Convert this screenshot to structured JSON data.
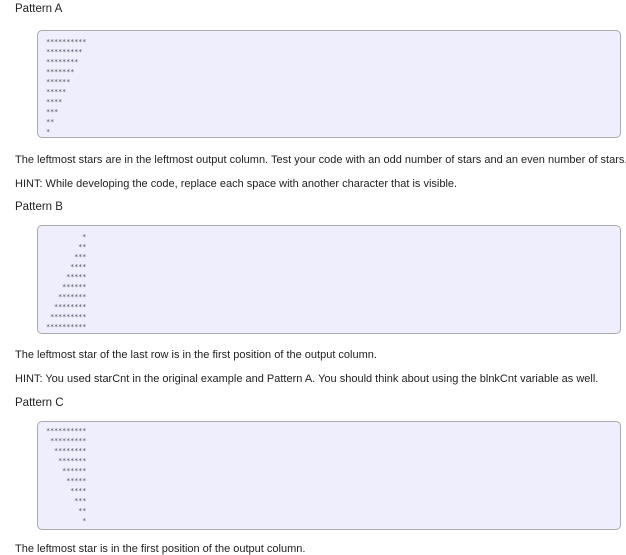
{
  "sections": [
    {
      "title": "Pattern A",
      "output": "**********\n*********\n********\n*******\n******\n*****\n****\n***\n**\n*",
      "notes": [
        "The leftmost stars are in the leftmost output column. Test your code with an odd number of stars and an even number of stars.",
        "HINT: While developing the code, replace each space with another character that is visible."
      ]
    },
    {
      "title": "Pattern B",
      "output": "         *\n        **\n       ***\n      ****\n     *****\n    ******\n   *******\n  ********\n *********\n**********",
      "notes": [
        "The leftmost star of the last row is in the first position of the output column.",
        "HINT: You used starCnt in the original example and Pattern A. You should think about using the blnkCnt variable as well."
      ]
    },
    {
      "title": "Pattern C",
      "output": "**********\n *********\n  ********\n   *******\n    ******\n     *****\n      ****\n       ***\n        **\n         *",
      "notes": [
        "The leftmost star is in the first position of the output column."
      ]
    }
  ]
}
